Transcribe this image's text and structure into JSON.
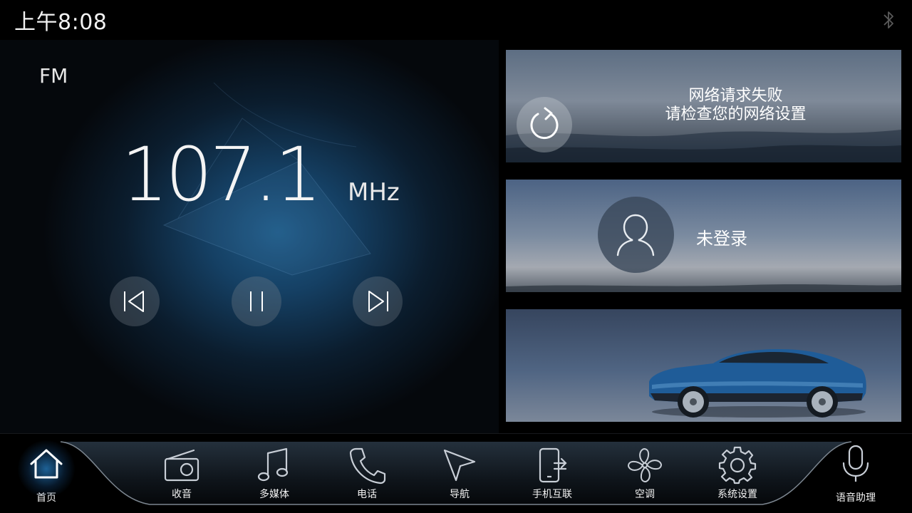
{
  "status_bar": {
    "time": "上午8:08",
    "bluetooth_icon": "bluetooth-icon"
  },
  "radio": {
    "band": "FM",
    "frequency": "107.1",
    "unit": "MHz",
    "controls": [
      {
        "name": "previous",
        "icon": "skip-previous-icon"
      },
      {
        "name": "pause",
        "icon": "pause-icon"
      },
      {
        "name": "next",
        "icon": "skip-next-icon"
      }
    ]
  },
  "network_card": {
    "line1": "网络请求失败",
    "line2": "请检查您的网络设置",
    "icon": "refresh-icon"
  },
  "account_card": {
    "label": "未登录",
    "icon": "user-icon"
  },
  "vehicle_card": {
    "image": "blue-suv-car"
  },
  "dock": {
    "items": [
      {
        "label": "首页",
        "icon": "home-icon",
        "active": true
      },
      {
        "label": "收音",
        "icon": "radio-icon"
      },
      {
        "label": "多媒体",
        "icon": "music-note-icon"
      },
      {
        "label": "电话",
        "icon": "phone-icon"
      },
      {
        "label": "导航",
        "icon": "navigation-icon"
      },
      {
        "label": "手机互联",
        "icon": "phone-link-icon"
      },
      {
        "label": "空调",
        "icon": "fan-icon"
      },
      {
        "label": "系统设置",
        "icon": "gear-icon"
      },
      {
        "label": "语音助理",
        "icon": "microphone-icon"
      }
    ]
  },
  "colors": {
    "accent": "#2d8ad6",
    "background": "#000000",
    "radio_glow": "#1f5a86"
  }
}
